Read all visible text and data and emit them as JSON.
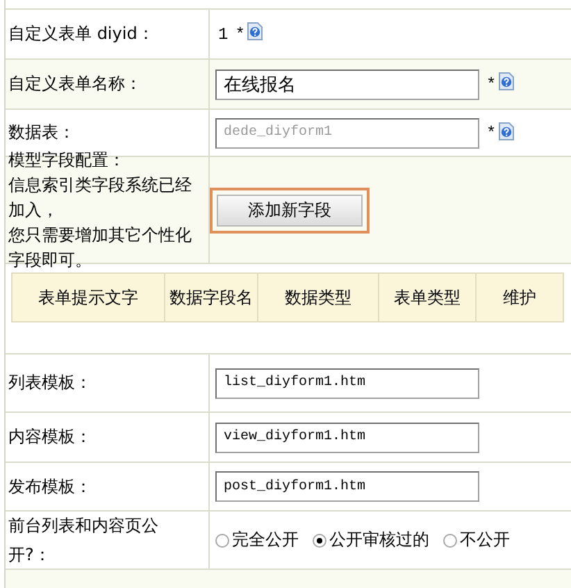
{
  "form": {
    "rows": [
      {
        "kind": "static",
        "label": "自定义表单 diyid：",
        "value": "1",
        "required": "*",
        "help": true
      },
      {
        "kind": "text",
        "label": "自定义表单名称：",
        "value": "在线报名",
        "disabled": false,
        "required": "*",
        "help": true
      },
      {
        "kind": "text",
        "label": "数据表：",
        "value": "dede_diyform1",
        "disabled": true,
        "required": "*",
        "help": true
      },
      {
        "kind": "button",
        "label_lines": [
          "模型字段配置：",
          "信息索引类字段系统已经",
          "加入，",
          "您只需要增加其它个性化",
          "字段即可。"
        ],
        "button": "添加新字段"
      },
      {
        "kind": "columns",
        "columns": [
          "表单提示文字",
          "数据字段名",
          "数据类型",
          "表单类型",
          "维护"
        ]
      },
      {
        "kind": "text",
        "label": "列表模板：",
        "value": "list_diyform1.htm",
        "disabled": false
      },
      {
        "kind": "text",
        "label": "内容模板：",
        "value": "view_diyform1.htm",
        "disabled": false
      },
      {
        "kind": "text",
        "label": "发布模板：",
        "value": "post_diyform1.htm",
        "disabled": false
      },
      {
        "kind": "radio",
        "label": "前台列表和内容页公开?：",
        "options": [
          {
            "label": "完全公开",
            "selected": false
          },
          {
            "label": "公开审核过的",
            "selected": true
          },
          {
            "label": "不公开",
            "selected": false
          }
        ]
      }
    ]
  }
}
